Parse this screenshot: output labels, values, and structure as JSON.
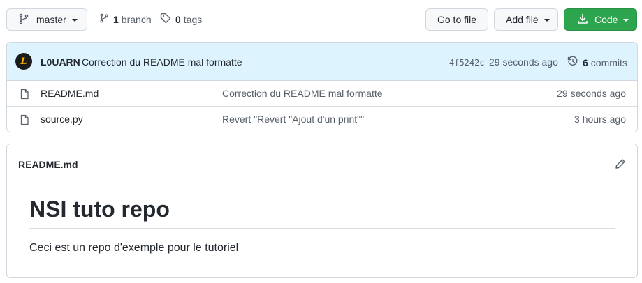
{
  "toolbar": {
    "branch_button_label": "master",
    "branch_count": "1",
    "branch_label": "branch",
    "tag_count": "0",
    "tag_label": "tags",
    "go_to_file_label": "Go to file",
    "add_file_label": "Add file",
    "code_label": "Code"
  },
  "latest_commit": {
    "author": "L0UARN",
    "avatar_letter": "L",
    "message": "Correction du README mal formatte",
    "sha": "4f5242c",
    "time": "29 seconds ago",
    "commit_count": "6",
    "commit_label": "commits"
  },
  "files": [
    {
      "name": "README.md",
      "message": "Correction du README mal formatte",
      "time": "29 seconds ago"
    },
    {
      "name": "source.py",
      "message": "Revert \"Revert \"Ajout d'un print\"\"",
      "time": "3 hours ago"
    }
  ],
  "readme": {
    "filename": "README.md",
    "heading": "NSI tuto repo",
    "paragraph": "Ceci est un repo d'exemple pour le tutoriel"
  },
  "colors": {
    "code_button": "#2da44e",
    "commit_bar": "#ddf4ff",
    "border": "#d0d7de",
    "avatar_bg": "#1b1b1b",
    "avatar_fg": "#f5b400"
  },
  "icons": [
    "git-branch-icon",
    "tag-icon",
    "download-icon",
    "history-icon",
    "file-icon",
    "pencil-icon"
  ]
}
